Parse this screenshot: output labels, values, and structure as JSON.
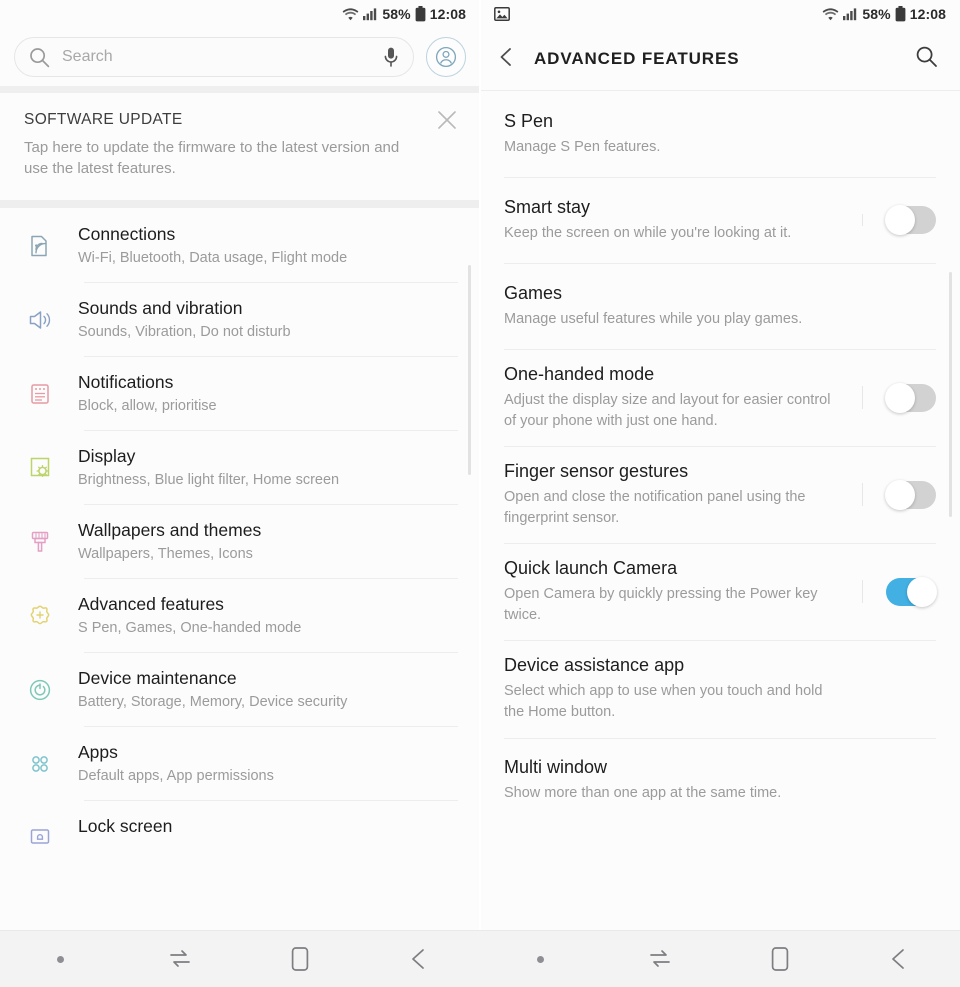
{
  "status_bar": {
    "wifi_icon": "wifi-icon",
    "signal_icon": "cellular-signal-icon",
    "battery_percent": "58%",
    "battery_icon": "battery-icon",
    "time": "12:08",
    "gallery_icon": "image-notification-icon"
  },
  "left_panel": {
    "search": {
      "placeholder": "Search",
      "search_icon": "search-icon",
      "mic_icon": "microphone-icon",
      "avatar_icon": "account-avatar-icon"
    },
    "banner": {
      "title": "SOFTWARE UPDATE",
      "body": "Tap here to update the firmware to the latest version and use the latest features.",
      "close_icon": "close-icon"
    },
    "items": [
      {
        "icon": "connections-icon",
        "icon_color": "#8aa6b4",
        "title": "Connections",
        "subtitle": "Wi-Fi, Bluetooth, Data usage, Flight mode"
      },
      {
        "icon": "sound-speaker-icon",
        "icon_color": "#8aa0c4",
        "title": "Sounds and vibration",
        "subtitle": "Sounds, Vibration, Do not disturb"
      },
      {
        "icon": "notifications-icon",
        "icon_color": "#e79aa4",
        "title": "Notifications",
        "subtitle": "Block, allow, prioritise"
      },
      {
        "icon": "display-brightness-icon",
        "icon_color": "#bcd46a",
        "title": "Display",
        "subtitle": "Brightness, Blue light filter, Home screen"
      },
      {
        "icon": "wallpaper-brush-icon",
        "icon_color": "#e3a0c4",
        "title": "Wallpapers and themes",
        "subtitle": "Wallpapers, Themes, Icons"
      },
      {
        "icon": "advanced-features-gear-icon",
        "icon_color": "#e3d272",
        "title": "Advanced features",
        "subtitle": "S Pen, Games, One-handed mode"
      },
      {
        "icon": "device-maintenance-icon",
        "icon_color": "#7fc8b8",
        "title": "Device maintenance",
        "subtitle": "Battery, Storage, Memory, Device security"
      },
      {
        "icon": "apps-grid-icon",
        "icon_color": "#7fc4cd",
        "title": "Apps",
        "subtitle": "Default apps, App permissions"
      },
      {
        "icon": "lock-screen-icon",
        "icon_color": "#9aa4d6",
        "title": "Lock screen",
        "subtitle": ""
      }
    ]
  },
  "right_panel": {
    "appbar": {
      "back_icon": "back-chevron-icon",
      "title": "ADVANCED FEATURES",
      "search_icon": "search-icon"
    },
    "items": [
      {
        "title": "S Pen",
        "subtitle": "Manage S Pen features.",
        "has_toggle": false,
        "toggle_on": false
      },
      {
        "title": "Smart stay",
        "subtitle": "Keep the screen on while you're looking at it.",
        "has_toggle": true,
        "toggle_on": false
      },
      {
        "title": "Games",
        "subtitle": "Manage useful features while you play games.",
        "has_toggle": false,
        "toggle_on": false
      },
      {
        "title": "One-handed mode",
        "subtitle": "Adjust the display size and layout for easier control of your phone with just one hand.",
        "has_toggle": true,
        "toggle_on": false
      },
      {
        "title": "Finger sensor gestures",
        "subtitle": "Open and close the notification panel using the fingerprint sensor.",
        "has_toggle": true,
        "toggle_on": false
      },
      {
        "title": "Quick launch Camera",
        "subtitle": "Open Camera by quickly pressing the Power key twice.",
        "has_toggle": true,
        "toggle_on": true
      },
      {
        "title": "Device assistance app",
        "subtitle": "Select which app to use when you touch and hold the Home button.",
        "has_toggle": false,
        "toggle_on": false
      },
      {
        "title": "Multi window",
        "subtitle": "Show more than one app at the same time.",
        "has_toggle": false,
        "toggle_on": false
      }
    ]
  },
  "nav_bar": {
    "buttons": [
      {
        "icon": "status-dot-icon",
        "label": ""
      },
      {
        "icon": "recents-icon",
        "label": ""
      },
      {
        "icon": "home-icon",
        "label": ""
      },
      {
        "icon": "back-arrow-icon",
        "label": ""
      }
    ]
  },
  "colors": {
    "toggle_on": "#42b0e3",
    "toggle_off": "#d2d2d2",
    "accent_blue": "#42b0e3"
  }
}
